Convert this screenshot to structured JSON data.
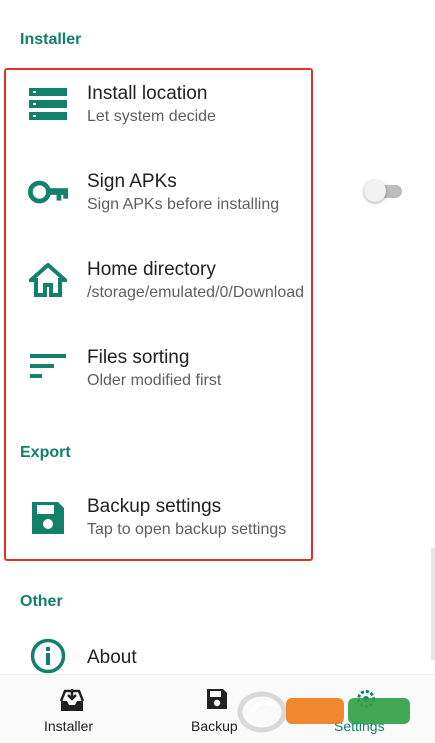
{
  "sections": {
    "installer": "Installer",
    "export": "Export",
    "other": "Other"
  },
  "prefs": {
    "install_location": {
      "title": "Install location",
      "summary": "Let system decide",
      "icon": "list-icon"
    },
    "sign_apks": {
      "title": "Sign APKs",
      "summary": "Sign APKs before installing",
      "icon": "key-icon",
      "enabled": false
    },
    "home_directory": {
      "title": "Home directory",
      "summary": "/storage/emulated/0/Download",
      "icon": "home-icon"
    },
    "files_sorting": {
      "title": "Files sorting",
      "summary": "Older modified first",
      "icon": "sort-icon"
    },
    "backup_settings": {
      "title": "Backup settings",
      "summary": "Tap to open backup settings",
      "icon": "save-icon"
    },
    "about": {
      "title": "About",
      "icon": "info-icon"
    }
  },
  "bottom_nav": {
    "installer": "Installer",
    "backup": "Backup",
    "settings": "Settings"
  },
  "colors": {
    "accent": "#12806a",
    "highlight": "#e0312b"
  }
}
